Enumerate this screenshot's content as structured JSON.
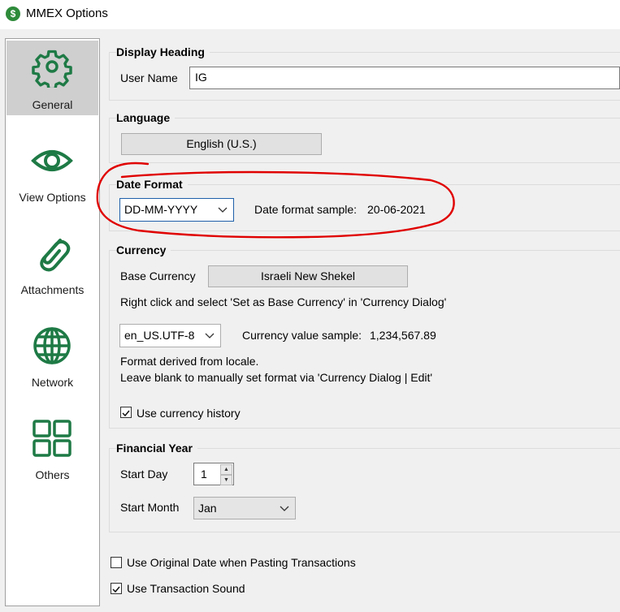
{
  "window": {
    "title": "MMEX Options",
    "app_icon": "$"
  },
  "sidebar": {
    "items": [
      {
        "label": "General",
        "icon": "gear-icon"
      },
      {
        "label": "View Options",
        "icon": "eye-icon"
      },
      {
        "label": "Attachments",
        "icon": "paperclip-icon"
      },
      {
        "label": "Network",
        "icon": "globe-icon"
      },
      {
        "label": "Others",
        "icon": "grid-icon"
      }
    ],
    "selected": "General",
    "icon_color": "#1e7a45"
  },
  "display_heading": {
    "title": "Display Heading",
    "user_name_label": "User Name",
    "user_name_value": "IG"
  },
  "language": {
    "title": "Language",
    "button_label": "English (U.S.)"
  },
  "date_format": {
    "title": "Date Format",
    "selected": "DD-MM-YYYY",
    "sample_label": "Date format sample:",
    "sample_value": "20-06-2021",
    "annotation_color": "#e00000"
  },
  "currency": {
    "title": "Currency",
    "base_label": "Base Currency",
    "base_value": "Israeli New Shekel",
    "hint": "Right click and select 'Set as Base Currency' in 'Currency Dialog'",
    "locale_selected": "en_US.UTF-8",
    "sample_label": "Currency value sample:",
    "sample_value": "1,234,567.89",
    "note_line1": "Format derived from locale.",
    "note_line2": "Leave blank to manually set format via 'Currency Dialog | Edit'",
    "history_label": "Use currency history",
    "history_checked": true
  },
  "financial_year": {
    "title": "Financial Year",
    "start_day_label": "Start Day",
    "start_day_value": "1",
    "start_month_label": "Start Month",
    "start_month_value": "Jan"
  },
  "options": {
    "original_date_label": "Use Original Date when Pasting Transactions",
    "original_date_checked": false,
    "sound_label": "Use Transaction Sound",
    "sound_checked": true
  }
}
